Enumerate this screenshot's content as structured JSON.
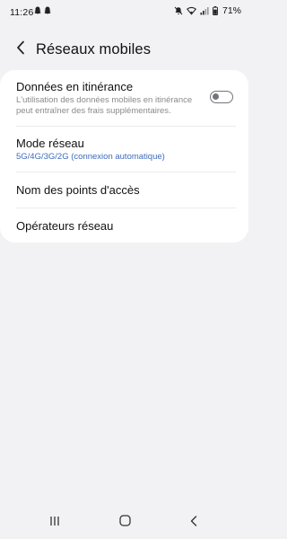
{
  "status_bar": {
    "time": "11:26",
    "battery": "71%"
  },
  "header": {
    "title": "Réseaux mobiles"
  },
  "settings": {
    "roaming": {
      "title": "Données en itinérance",
      "description": "L'utilisation des données mobiles en itinérance peut entraîner des frais supplémentaires.",
      "enabled": false
    },
    "network_mode": {
      "title": "Mode réseau",
      "value": "5G/4G/3G/2G (connexion automatique)"
    },
    "apn": {
      "title": "Nom des points d'accès"
    },
    "operators": {
      "title": "Opérateurs réseau"
    }
  },
  "colors": {
    "background": "#f2f2f4",
    "card": "#ffffff",
    "accent_link": "#3e6bbd",
    "secondary_text": "#8a8a8e"
  }
}
